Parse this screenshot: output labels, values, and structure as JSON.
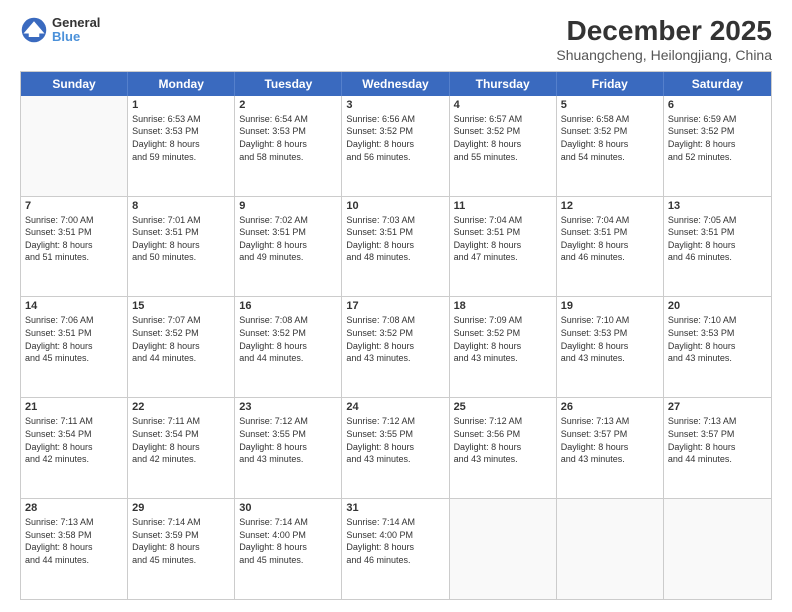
{
  "header": {
    "logo_line1": "General",
    "logo_line2": "Blue",
    "title": "December 2025",
    "subtitle": "Shuangcheng, Heilongjiang, China"
  },
  "weekdays": [
    "Sunday",
    "Monday",
    "Tuesday",
    "Wednesday",
    "Thursday",
    "Friday",
    "Saturday"
  ],
  "rows": [
    [
      {
        "day": "",
        "text": ""
      },
      {
        "day": "1",
        "text": "Sunrise: 6:53 AM\nSunset: 3:53 PM\nDaylight: 8 hours\nand 59 minutes."
      },
      {
        "day": "2",
        "text": "Sunrise: 6:54 AM\nSunset: 3:53 PM\nDaylight: 8 hours\nand 58 minutes."
      },
      {
        "day": "3",
        "text": "Sunrise: 6:56 AM\nSunset: 3:52 PM\nDaylight: 8 hours\nand 56 minutes."
      },
      {
        "day": "4",
        "text": "Sunrise: 6:57 AM\nSunset: 3:52 PM\nDaylight: 8 hours\nand 55 minutes."
      },
      {
        "day": "5",
        "text": "Sunrise: 6:58 AM\nSunset: 3:52 PM\nDaylight: 8 hours\nand 54 minutes."
      },
      {
        "day": "6",
        "text": "Sunrise: 6:59 AM\nSunset: 3:52 PM\nDaylight: 8 hours\nand 52 minutes."
      }
    ],
    [
      {
        "day": "7",
        "text": "Sunrise: 7:00 AM\nSunset: 3:51 PM\nDaylight: 8 hours\nand 51 minutes."
      },
      {
        "day": "8",
        "text": "Sunrise: 7:01 AM\nSunset: 3:51 PM\nDaylight: 8 hours\nand 50 minutes."
      },
      {
        "day": "9",
        "text": "Sunrise: 7:02 AM\nSunset: 3:51 PM\nDaylight: 8 hours\nand 49 minutes."
      },
      {
        "day": "10",
        "text": "Sunrise: 7:03 AM\nSunset: 3:51 PM\nDaylight: 8 hours\nand 48 minutes."
      },
      {
        "day": "11",
        "text": "Sunrise: 7:04 AM\nSunset: 3:51 PM\nDaylight: 8 hours\nand 47 minutes."
      },
      {
        "day": "12",
        "text": "Sunrise: 7:04 AM\nSunset: 3:51 PM\nDaylight: 8 hours\nand 46 minutes."
      },
      {
        "day": "13",
        "text": "Sunrise: 7:05 AM\nSunset: 3:51 PM\nDaylight: 8 hours\nand 46 minutes."
      }
    ],
    [
      {
        "day": "14",
        "text": "Sunrise: 7:06 AM\nSunset: 3:51 PM\nDaylight: 8 hours\nand 45 minutes."
      },
      {
        "day": "15",
        "text": "Sunrise: 7:07 AM\nSunset: 3:52 PM\nDaylight: 8 hours\nand 44 minutes."
      },
      {
        "day": "16",
        "text": "Sunrise: 7:08 AM\nSunset: 3:52 PM\nDaylight: 8 hours\nand 44 minutes."
      },
      {
        "day": "17",
        "text": "Sunrise: 7:08 AM\nSunset: 3:52 PM\nDaylight: 8 hours\nand 43 minutes."
      },
      {
        "day": "18",
        "text": "Sunrise: 7:09 AM\nSunset: 3:52 PM\nDaylight: 8 hours\nand 43 minutes."
      },
      {
        "day": "19",
        "text": "Sunrise: 7:10 AM\nSunset: 3:53 PM\nDaylight: 8 hours\nand 43 minutes."
      },
      {
        "day": "20",
        "text": "Sunrise: 7:10 AM\nSunset: 3:53 PM\nDaylight: 8 hours\nand 43 minutes."
      }
    ],
    [
      {
        "day": "21",
        "text": "Sunrise: 7:11 AM\nSunset: 3:54 PM\nDaylight: 8 hours\nand 42 minutes."
      },
      {
        "day": "22",
        "text": "Sunrise: 7:11 AM\nSunset: 3:54 PM\nDaylight: 8 hours\nand 42 minutes."
      },
      {
        "day": "23",
        "text": "Sunrise: 7:12 AM\nSunset: 3:55 PM\nDaylight: 8 hours\nand 43 minutes."
      },
      {
        "day": "24",
        "text": "Sunrise: 7:12 AM\nSunset: 3:55 PM\nDaylight: 8 hours\nand 43 minutes."
      },
      {
        "day": "25",
        "text": "Sunrise: 7:12 AM\nSunset: 3:56 PM\nDaylight: 8 hours\nand 43 minutes."
      },
      {
        "day": "26",
        "text": "Sunrise: 7:13 AM\nSunset: 3:57 PM\nDaylight: 8 hours\nand 43 minutes."
      },
      {
        "day": "27",
        "text": "Sunrise: 7:13 AM\nSunset: 3:57 PM\nDaylight: 8 hours\nand 44 minutes."
      }
    ],
    [
      {
        "day": "28",
        "text": "Sunrise: 7:13 AM\nSunset: 3:58 PM\nDaylight: 8 hours\nand 44 minutes."
      },
      {
        "day": "29",
        "text": "Sunrise: 7:14 AM\nSunset: 3:59 PM\nDaylight: 8 hours\nand 45 minutes."
      },
      {
        "day": "30",
        "text": "Sunrise: 7:14 AM\nSunset: 4:00 PM\nDaylight: 8 hours\nand 45 minutes."
      },
      {
        "day": "31",
        "text": "Sunrise: 7:14 AM\nSunset: 4:00 PM\nDaylight: 8 hours\nand 46 minutes."
      },
      {
        "day": "",
        "text": ""
      },
      {
        "day": "",
        "text": ""
      },
      {
        "day": "",
        "text": ""
      }
    ]
  ]
}
